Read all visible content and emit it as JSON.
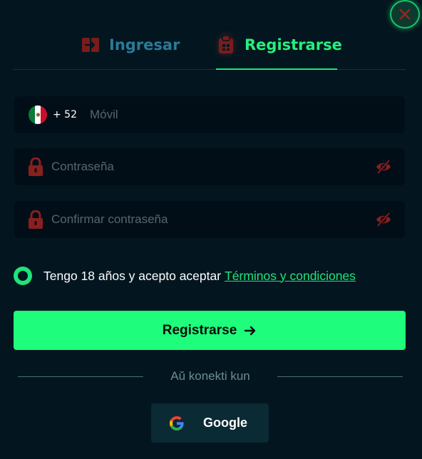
{
  "tabs": {
    "login_label": "Ingresar",
    "register_label": "Registrarse",
    "active": "register"
  },
  "form": {
    "phone": {
      "dial_code": "+ 52",
      "placeholder": "Móvil",
      "country_flag": "mexico-flag-icon"
    },
    "password": {
      "placeholder": "Contraseña"
    },
    "confirm_password": {
      "placeholder": "Confirmar contraseña"
    },
    "terms": {
      "text": "Tengo 18 años y acepto aceptar",
      "link": "Términos y condiciones",
      "checked": true
    },
    "submit_label": "Registrarse"
  },
  "social": {
    "divider_text": "Aŭ konekti kun",
    "google_label": "Google"
  },
  "colors": {
    "background": "#03161f",
    "accent": "#1ee57a",
    "inactive_tab": "#2c7a97",
    "icon_red": "#8a1f1f"
  }
}
